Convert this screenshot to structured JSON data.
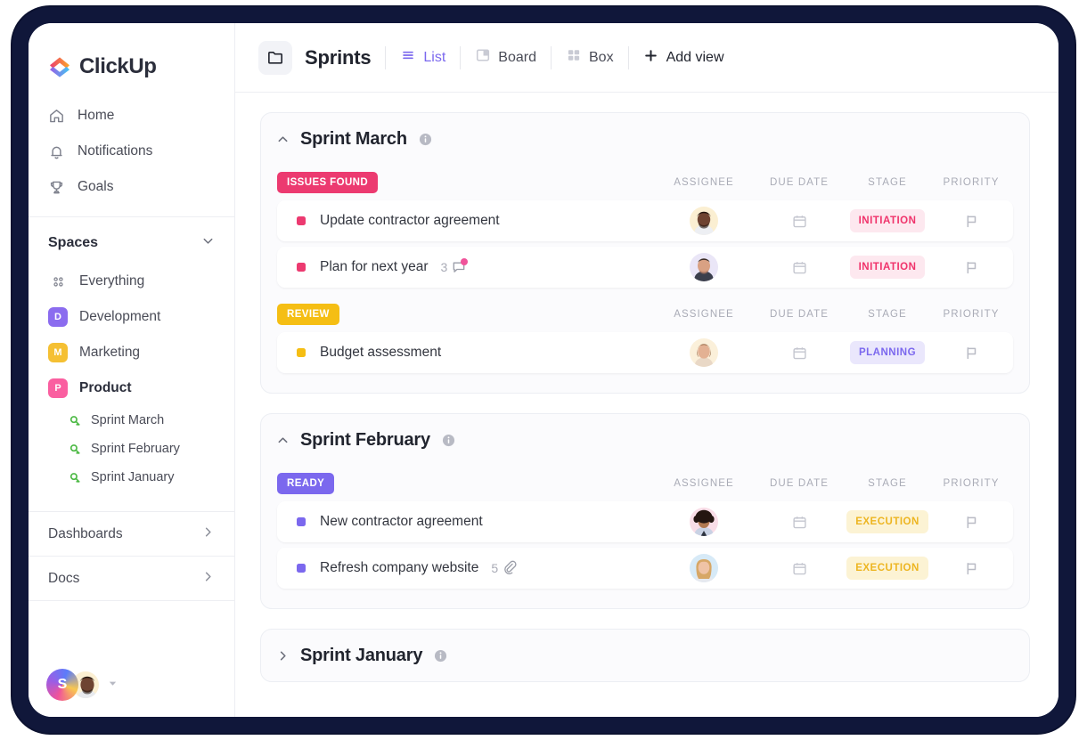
{
  "brand": {
    "name": "ClickUp"
  },
  "sidebar": {
    "nav": [
      {
        "label": "Home",
        "icon": "home-icon"
      },
      {
        "label": "Notifications",
        "icon": "bell-icon"
      },
      {
        "label": "Goals",
        "icon": "trophy-icon"
      }
    ],
    "spaces_title": "Spaces",
    "spaces": [
      {
        "label": "Everything",
        "icon": "grid-dots-icon",
        "chip": null,
        "color": null,
        "active": false
      },
      {
        "label": "Development",
        "chip": "D",
        "color": "#8B6CEF",
        "active": false
      },
      {
        "label": "Marketing",
        "chip": "M",
        "color": "#F5C033",
        "active": false
      },
      {
        "label": "Product",
        "chip": "P",
        "color": "#FA5FA0",
        "active": true
      }
    ],
    "sprints": [
      {
        "label": "Sprint  March"
      },
      {
        "label": "Sprint  February"
      },
      {
        "label": "Sprint January"
      }
    ],
    "bottom_links": [
      {
        "label": "Dashboards"
      },
      {
        "label": "Docs"
      }
    ],
    "workspace_initial": "S"
  },
  "topbar": {
    "title": "Sprints",
    "views": [
      {
        "label": "List",
        "icon": "list-icon",
        "active": true
      },
      {
        "label": "Board",
        "icon": "board-icon",
        "active": false
      },
      {
        "label": "Box",
        "icon": "box-icon",
        "active": false
      }
    ],
    "add_view_label": "Add view"
  },
  "columns": [
    "ASSIGNEE",
    "DUE DATE",
    "STAGE",
    "PRIORITY"
  ],
  "sprints": [
    {
      "name": "Sprint March",
      "expanded": true,
      "groups": [
        {
          "status": "ISSUES FOUND",
          "status_color": "#EC3A70",
          "tasks": [
            {
              "name": "Update contractor agreement",
              "dot_color": "#EC3A70",
              "meta": null,
              "meta_icon": null,
              "meta_dot": false,
              "assignee_bg": "#FBEFD2",
              "assignee_skin": "#6E4331",
              "assignee_hair": "#23150F",
              "stage": "INITIATION",
              "stage_color": "#F0336B",
              "stage_bg": "#FDE8EF"
            },
            {
              "name": "Plan for next year",
              "dot_color": "#EC3A70",
              "meta": "3",
              "meta_icon": "comment-icon",
              "meta_dot": true,
              "assignee_bg": "#EAE6F7",
              "assignee_skin": "#D9A183",
              "assignee_hair": "#3B2C25",
              "stage": "INITIATION",
              "stage_color": "#F0336B",
              "stage_bg": "#FDE8EF"
            }
          ]
        },
        {
          "status": "REVIEW",
          "status_color": "#F5BE14",
          "tasks": [
            {
              "name": "Budget assessment",
              "dot_color": "#F5BE14",
              "meta": null,
              "meta_icon": null,
              "meta_dot": false,
              "assignee_bg": "#FBF0DA",
              "assignee_skin": "#E3B193",
              "assignee_hair": "#8A5A36",
              "stage": "PLANNING",
              "stage_color": "#7B68EE",
              "stage_bg": "#EAE7FC"
            }
          ]
        }
      ]
    },
    {
      "name": "Sprint February",
      "expanded": true,
      "groups": [
        {
          "status": "READY",
          "status_color": "#7B68EE",
          "tasks": [
            {
              "name": "New contractor agreement",
              "dot_color": "#7B68EE",
              "meta": null,
              "meta_icon": null,
              "meta_dot": false,
              "assignee_bg": "#F9DDE7",
              "assignee_skin": "#B07850",
              "assignee_hair": "#241611",
              "stage": "EXECUTION",
              "stage_color": "#EDB521",
              "stage_bg": "#FCF3D4"
            },
            {
              "name": "Refresh company website",
              "dot_color": "#7B68EE",
              "meta": "5",
              "meta_icon": "attachment-icon",
              "meta_dot": false,
              "assignee_bg": "#D7EAF7",
              "assignee_skin": "#EFC3A6",
              "assignee_hair": "#D7A766",
              "stage": "EXECUTION",
              "stage_color": "#EDB521",
              "stage_bg": "#FCF3D4"
            }
          ]
        }
      ]
    },
    {
      "name": "Sprint January",
      "expanded": false,
      "groups": []
    }
  ]
}
